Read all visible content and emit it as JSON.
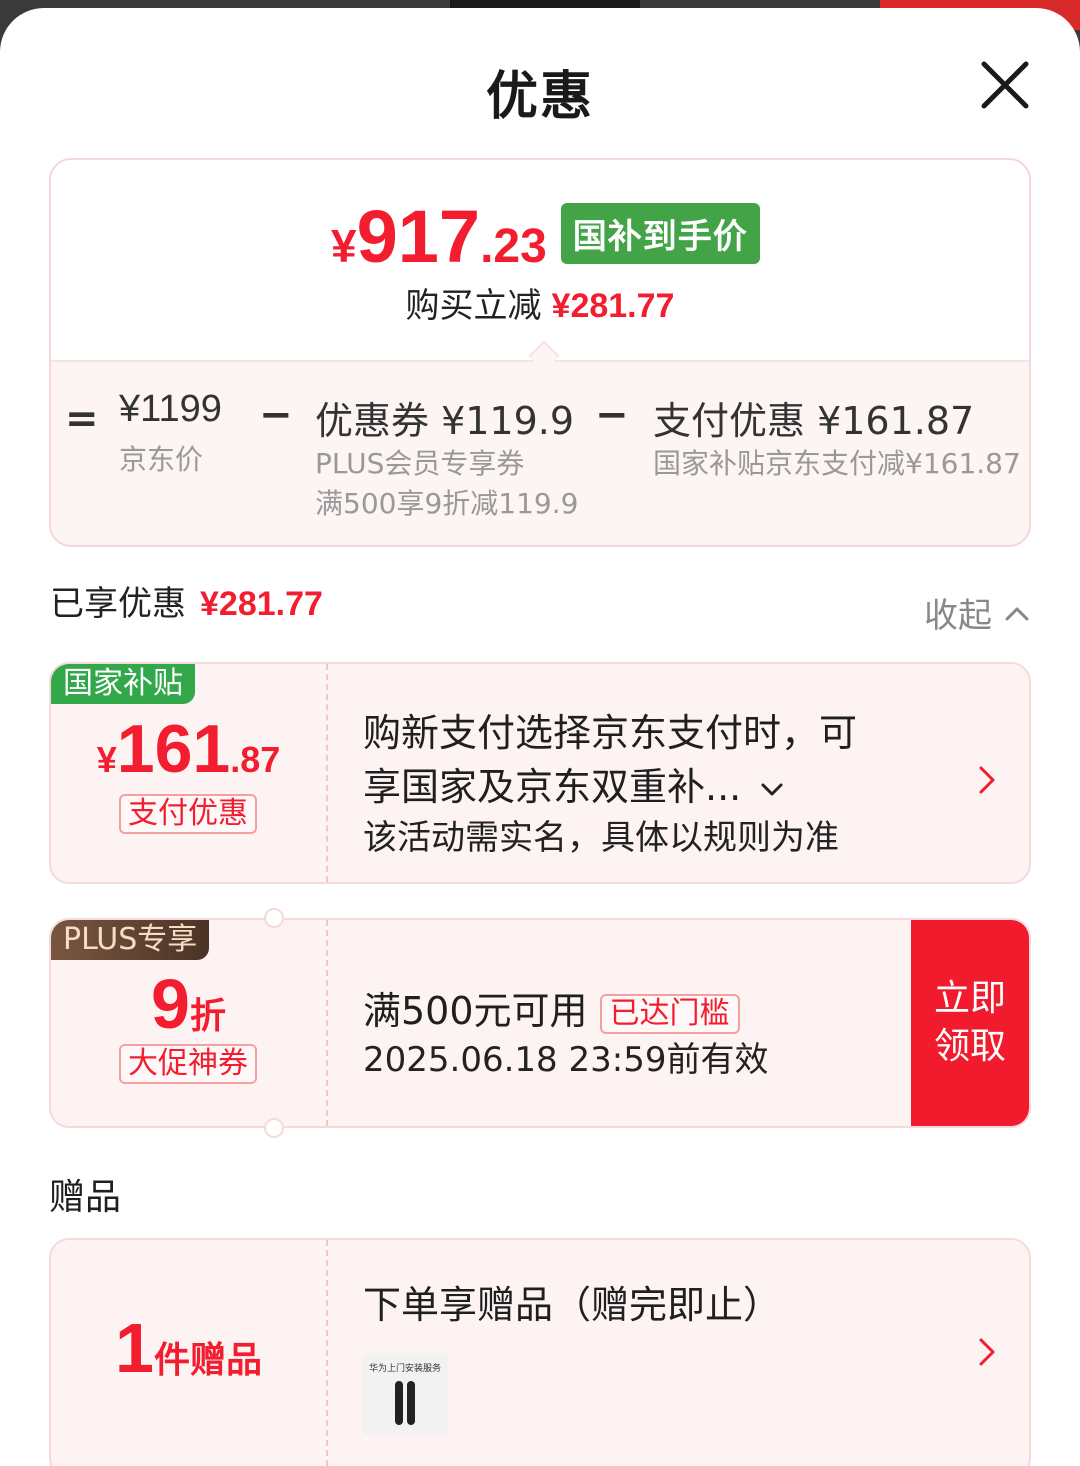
{
  "sheet": {
    "title": "优惠"
  },
  "summary": {
    "final_price_symbol": "¥",
    "final_price_int": "917",
    "final_price_dec": ".23",
    "final_price_tag": "国补到手价",
    "reduce_label": "购买立减",
    "reduce_amount": "¥281.77",
    "calc": {
      "eq": "=",
      "minus1": "−",
      "minus2": "−",
      "base_price": "¥1199",
      "base_label": "京东价",
      "coupon_main": "优惠券 ¥119.9",
      "coupon_sub1": "PLUS会员专享券",
      "coupon_sub2": "满500享9折减119.9",
      "pay_main": "支付优惠 ¥161.87",
      "pay_sub": "国家补贴京东支付减¥161.87"
    }
  },
  "enjoyed": {
    "label": "已享优惠",
    "amount": "¥281.77",
    "collapse_label": "收起"
  },
  "cards": {
    "subsidy": {
      "corner_tag": "国家补贴",
      "amount_symbol": "¥",
      "amount_int": "161",
      "amount_dec": ".87",
      "type_tag": "支付优惠",
      "desc_line1": "购新支付选择京东支付时，可",
      "desc_line2": "享国家及京东双重补...",
      "desc_line3": "该活动需实名，具体以规则为准"
    },
    "plus": {
      "corner_tag": "PLUS专享",
      "discount_num": "9",
      "discount_unit": "折",
      "type_tag": "大促神券",
      "condition": "满500元可用",
      "reached_tag": "已达门槛",
      "validity": "2025.06.18 23:59前有效",
      "claim_line1": "立即",
      "claim_line2": "领取"
    },
    "gift": {
      "count_num": "1",
      "count_label": "件赠品",
      "title": "下单享赠品（赠完即止）",
      "thumb_text": "华为上门安装服务"
    }
  },
  "section": {
    "gift_label": "赠品"
  },
  "colors": {
    "accent_red": "#f21d2f",
    "green_tag": "#43a347",
    "card_bg": "#fdf3f3"
  },
  "icons": [
    "close-icon",
    "chevron-up-icon",
    "chevron-down-icon",
    "chevron-right-icon"
  ]
}
